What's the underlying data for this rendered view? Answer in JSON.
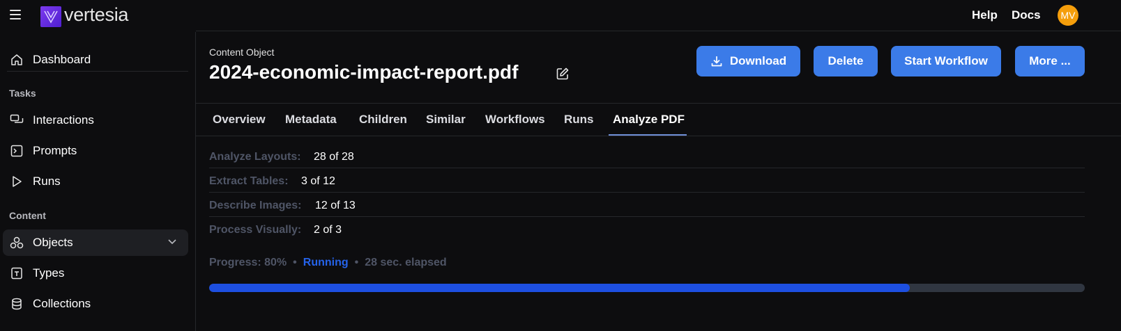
{
  "topbar": {
    "logo_text": "vertesia",
    "help_label": "Help",
    "docs_label": "Docs",
    "avatar_initials": "MV"
  },
  "sidebar": {
    "dashboard": "Dashboard",
    "tasks_section": "Tasks",
    "interactions": "Interactions",
    "prompts": "Prompts",
    "runs": "Runs",
    "content_section": "Content",
    "objects": "Objects",
    "types": "Types",
    "collections": "Collections"
  },
  "header": {
    "subtitle": "Content Object",
    "title": "2024-economic-impact-report.pdf",
    "download_label": "Download",
    "delete_label": "Delete",
    "start_workflow_label": "Start Workflow",
    "more_label": "More ..."
  },
  "tabs": [
    "Overview",
    "Metadata",
    "Children",
    "Similar",
    "Workflows",
    "Runs",
    "Analyze PDF"
  ],
  "active_tab": "Analyze PDF",
  "stats": [
    {
      "key": "Analyze Layouts:",
      "value": "28 of 28"
    },
    {
      "key": "Extract Tables:",
      "value": "3 of 12"
    },
    {
      "key": "Describe Images:",
      "value": "12 of 13"
    },
    {
      "key": "Process Visually:",
      "value": "2 of 3"
    }
  ],
  "progress": {
    "label": "Progress: 80%",
    "status": "Running",
    "elapsed": "28 sec. elapsed",
    "fraction": 0.8
  },
  "colors": {
    "accent": "#3b7be8",
    "running": "#2563eb",
    "avatar": "#f59e0b"
  }
}
